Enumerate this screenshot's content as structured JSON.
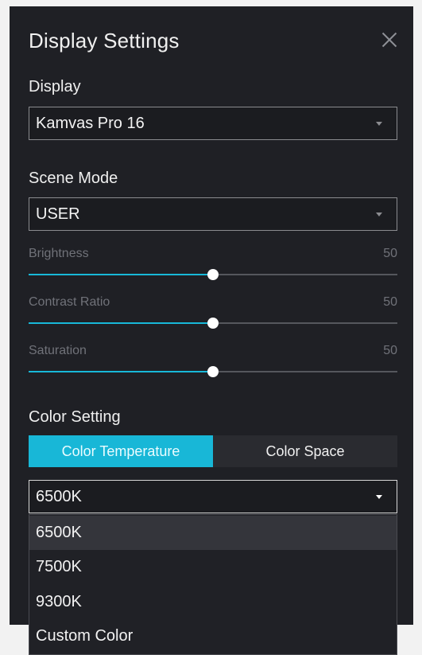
{
  "window": {
    "title": "Display Settings"
  },
  "display": {
    "label": "Display",
    "selected": "Kamvas Pro 16"
  },
  "scene_mode": {
    "label": "Scene Mode",
    "selected": "USER"
  },
  "sliders": [
    {
      "label": "Brightness",
      "value": "50",
      "fraction": 0.5
    },
    {
      "label": "Contrast Ratio",
      "value": "50",
      "fraction": 0.5
    },
    {
      "label": "Saturation",
      "value": "50",
      "fraction": 0.5
    }
  ],
  "color_setting": {
    "label": "Color Setting",
    "tabs": [
      {
        "label": "Color Temperature",
        "active": true
      },
      {
        "label": "Color Space",
        "active": false
      }
    ],
    "temperature": {
      "selected": "6500K",
      "options": [
        "6500K",
        "7500K",
        "9300K",
        "Custom Color"
      ],
      "highlighted": "6500K"
    }
  },
  "colors": {
    "accent": "#18b7d7",
    "panel_bg": "#1f2025",
    "text": "#efefef",
    "muted_text": "#707279"
  },
  "icons": {
    "close": "close-icon",
    "dropdown": "chevron-down-icon"
  }
}
